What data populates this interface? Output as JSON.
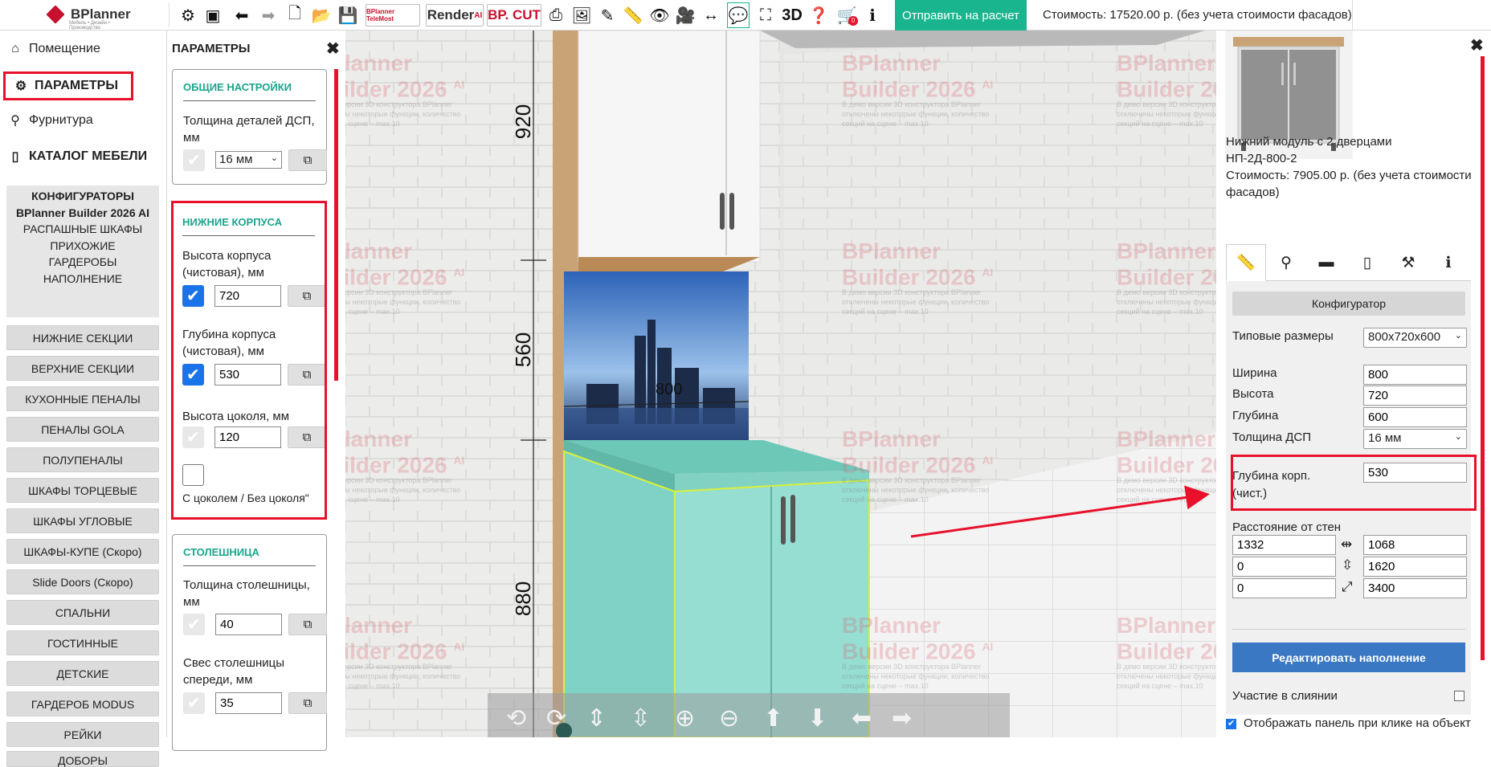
{
  "app": {
    "logo_text": "BPlanner",
    "logo_sub": "Мебель • Дизайн • Производство"
  },
  "toolbar": {
    "telemost_label": "BPlanner TeleMost",
    "render_label": "Render",
    "render_ai": "AI",
    "cut_label": "BP. CUT",
    "view3d_label": "3D",
    "cart_count": "0",
    "send_label": "Отправить на расчет",
    "total_label": "Стоимость: 17520.00 р. (без учета стоимости фасадов)"
  },
  "leftnav": {
    "room": "Помещение",
    "params": "ПАРАМЕТРЫ",
    "hardware": "Фурнитура",
    "catalog": "КАТАЛОГ МЕБЕЛИ",
    "configurators": [
      "КОНФИГУРАТОРЫ",
      "BPlanner Builder 2026 AI",
      "РАСПАШНЫЕ ШКАФЫ",
      "ПРИХОЖИЕ",
      "ГАРДЕРОБЫ",
      "НАПОЛНЕНИЕ"
    ],
    "categories": [
      "НИЖНИЕ СЕКЦИИ",
      "ВЕРХНИЕ СЕКЦИИ",
      "КУХОННЫЕ ПЕНАЛЫ",
      "ПЕНАЛЫ GOLA",
      "ПОЛУПЕНАЛЫ",
      "ШКАФЫ ТОРЦЕВЫЕ",
      "ШКАФЫ УГЛОВЫЕ",
      "ШКАФЫ-КУПЕ (Скоро)",
      "Slide Doors (Скоро)",
      "СПАЛЬНИ",
      "ГОСТИННЫЕ",
      "ДЕТСКИЕ",
      "ГАРДЕРОБ MODUS",
      "РЕЙКИ",
      "ДОБОРЫ"
    ]
  },
  "params": {
    "title": "ПАРАМЕТРЫ",
    "general": {
      "header": "ОБЩИЕ НАСТРОЙКИ",
      "thickness_label": "Толщина деталей ДСП, мм",
      "thickness_value": "16 мм"
    },
    "lower": {
      "header": "НИЖНИЕ КОРПУСА",
      "height_label": "Высота корпуса (чистовая), мм",
      "height_value": "720",
      "depth_label": "Глубина корпуса (чистовая), мм",
      "depth_value": "530",
      "plinth_label": "Высота цоколя, мм",
      "plinth_value": "120",
      "plinth_toggle_label": "С цоколем / Без цоколя\""
    },
    "worktop": {
      "header": "СТОЛЕШНИЦА",
      "thickness_label": "Толщина столешницы, мм",
      "thickness_value": "40",
      "overhang_label": "Свес столешницы спереди, мм",
      "overhang_value": "35"
    }
  },
  "canvas": {
    "watermark_title": "BPlanner",
    "watermark_sub": "Builder 2026",
    "watermark_ai": "AI",
    "watermark_note": "В демо версии 3D конструктора BPlanner отключены некоторые функции, количество секций на сцене – max.10",
    "dims": [
      "920",
      "560",
      "880",
      "800"
    ]
  },
  "right": {
    "product_name": "Нижний модуль с 2 дверцами",
    "product_code": "НП-2Д-800-2",
    "product_cost": "Стоимость: 7905.00 р. (без учета стоимости фасадов)",
    "configurator_label": "Конфигуратор",
    "typical_label": "Типовые размеры",
    "typical_value": "800x720x600",
    "width_label": "Ширина",
    "width_value": "800",
    "height_label": "Высота",
    "height_value": "720",
    "depth_label": "Глубина",
    "depth_value": "600",
    "thickness_label": "Толщина ДСП",
    "thickness_value": "16 мм",
    "body_depth_label": "Глубина корп. (чист.)",
    "body_depth_value": "530",
    "walls_label": "Расстояние от стен",
    "walls": [
      "1332",
      "1068",
      "0",
      "1620",
      "0",
      "3400"
    ],
    "edit_label": "Редактировать наполнение",
    "merge_label": "Участие в слиянии",
    "show_panel_label": "Отображать панель при клике на объект"
  },
  "colors": {
    "accent_green": "#19b58e",
    "highlight_red": "#e8102a",
    "primary_blue": "#3a78c3",
    "link_teal": "#1aa58c"
  }
}
